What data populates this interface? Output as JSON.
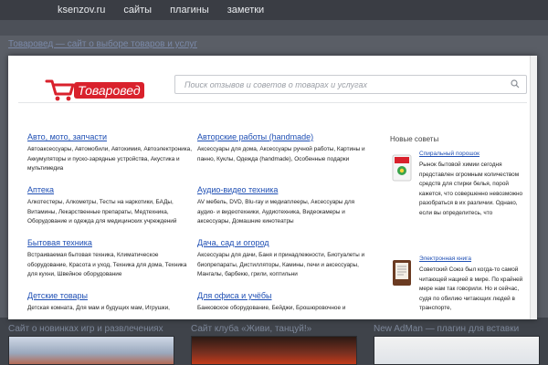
{
  "nav": {
    "brand": "ksenzov.ru",
    "items": [
      "сайты",
      "плагины",
      "заметки"
    ]
  },
  "background": {
    "title": "Товаровед — сайт о выборе товаров и услуг",
    "bottom_titles": [
      "Сайт о новинках игр и развлечениях",
      "Сайт клуба «Живи, танцуй!»",
      "New AdMan — плагин для вставки рекламы"
    ]
  },
  "modal": {
    "logo_text": "Товаровед",
    "search_placeholder": "Поиск отзывов и советов о товарах и услугах",
    "categories": [
      {
        "title": "Авто, мото, запчасти",
        "desc": "Автоаксессуары, Автомобили, Автохимия, Автоэлектроника, Аккумуляторы и пуско-зарядные устройства, Акустика и мультимедиа"
      },
      {
        "title": "Авторские работы (handmade)",
        "desc": "Аксессуары для дома, Аксессуары ручной работы, Картины и панно, Куклы, Одежда (handmade), Особенные подарки"
      },
      {
        "title": "Аптека",
        "desc": "Алкотестеры, Алкометры, Тесты на наркотики, БАДы, Витамины, Лекарственные препараты, Медтехника, Оборудование и одежда для медицинских учреждений"
      },
      {
        "title": "Аудио-видео техника",
        "desc": "AV мебель, DVD, Blu-ray и медиаплееры, Аксессуары для аудио- и видеотехники, Аудиотехника, Видеокамеры и аксессуары, Домашние кинотеатры"
      },
      {
        "title": "Бытовая техника",
        "desc": "Встраиваемая бытовая техника, Климатическое оборудование, Красота и уход, Техника для дома, Техника для кухни, Швейное оборудование"
      },
      {
        "title": "Дача, сад и огород",
        "desc": "Аксессуары для дачи, Баня и принадлежности, Биотуалеты и биопрепараты, Дистилляторы, Камины, печи и аксессуары, Мангалы, барбекю, грили, коптильни"
      },
      {
        "title": "Детские товары",
        "desc": "Детская комната, Для мам и будущих мам, Игрушки,"
      },
      {
        "title": "Для офиса и учёбы",
        "desc": "Банковское оборудование, Бейджи, Брошюровочное и"
      }
    ],
    "sidebar": {
      "title": "Новые советы",
      "tips": [
        {
          "title": "Спиральный порошок",
          "text": "Рынок бытовой химии сегодня представлен огромным количеством средств для стирки белья, порой кажется, что совершенно невозможно разобраться в их различии. Однако, если вы определитесь, что"
        },
        {
          "title": "Электронная книга",
          "text": "Советский Союз был когда-то самой читающей нацией в мире. По крайней мере нам так говорили. Но и сейчас, судя по обилию читающих людей в транспорте,"
        }
      ]
    }
  }
}
